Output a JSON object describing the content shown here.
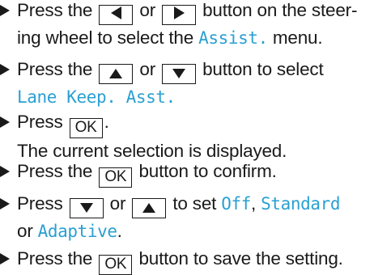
{
  "accent_color": "#2aa0d2",
  "icons": [
    "bullet-triangle-icon",
    "left-arrow-icon",
    "right-arrow-icon",
    "up-arrow-icon",
    "down-arrow-icon"
  ],
  "steps": [
    {
      "a": "Press the",
      "or": "or",
      "b": "button on the steer-",
      "c": "ing wheel to select the",
      "menu": "Assist.",
      "d": "menu."
    },
    {
      "a": "Press the",
      "or": "or",
      "b": "button to select",
      "item": "Lane Keep. Asst."
    },
    {
      "a": "Press",
      "key": "OK",
      "b": ".",
      "c": "The current selection is displayed."
    },
    {
      "a": "Press the",
      "key": "OK",
      "b": "button to confirm."
    },
    {
      "a": "Press",
      "or": "or",
      "b": "to set",
      "opt1": "Off",
      "sep": ",",
      "opt2": "Standard",
      "c": "or",
      "opt3": "Adaptive",
      "d": "."
    },
    {
      "a": "Press the",
      "key": "OK",
      "b": "button to save the setting."
    }
  ]
}
